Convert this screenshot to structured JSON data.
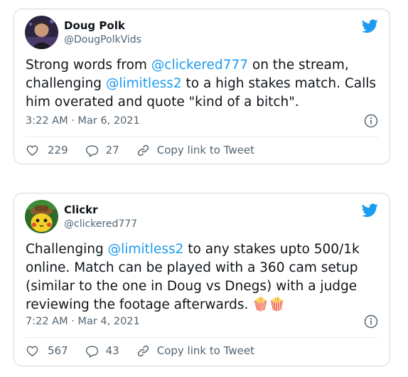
{
  "tweets": [
    {
      "display_name": "Doug Polk",
      "handle": "@DougPolkVids",
      "text_parts": [
        "Strong words from ",
        "@clickered777",
        " on the stream, challenging ",
        "@limitless2",
        " to a high stakes match. Calls him overated and quote \"kind of a bitch\"."
      ],
      "timestamp": "3:22 AM · Mar 6, 2021",
      "likes": "229",
      "replies": "27",
      "copy_link_label": "Copy link to Tweet",
      "avatar_icon": "doug-polk-avatar"
    },
    {
      "display_name": "Clickr",
      "handle": "@clickered777",
      "text_parts": [
        "Challenging ",
        "@limitless2",
        " to any stakes upto 500/1k online. Match can be played with a 360 cam setup (similar to the one in Doug vs Dnegs) with a judge reviewing the footage afterwards. ",
        "🍿🍿"
      ],
      "timestamp": "7:22 AM · Mar 4, 2021",
      "likes": "567",
      "replies": "43",
      "copy_link_label": "Copy link to Tweet",
      "avatar_icon": "pikachu-avatar"
    }
  ],
  "colors": {
    "brand_blue": "#1d9bf0",
    "secondary_text": "#536471",
    "border": "#cfd9de"
  },
  "icons": [
    "twitter-bird-icon",
    "info-icon",
    "heart-icon",
    "reply-icon",
    "link-icon"
  ]
}
